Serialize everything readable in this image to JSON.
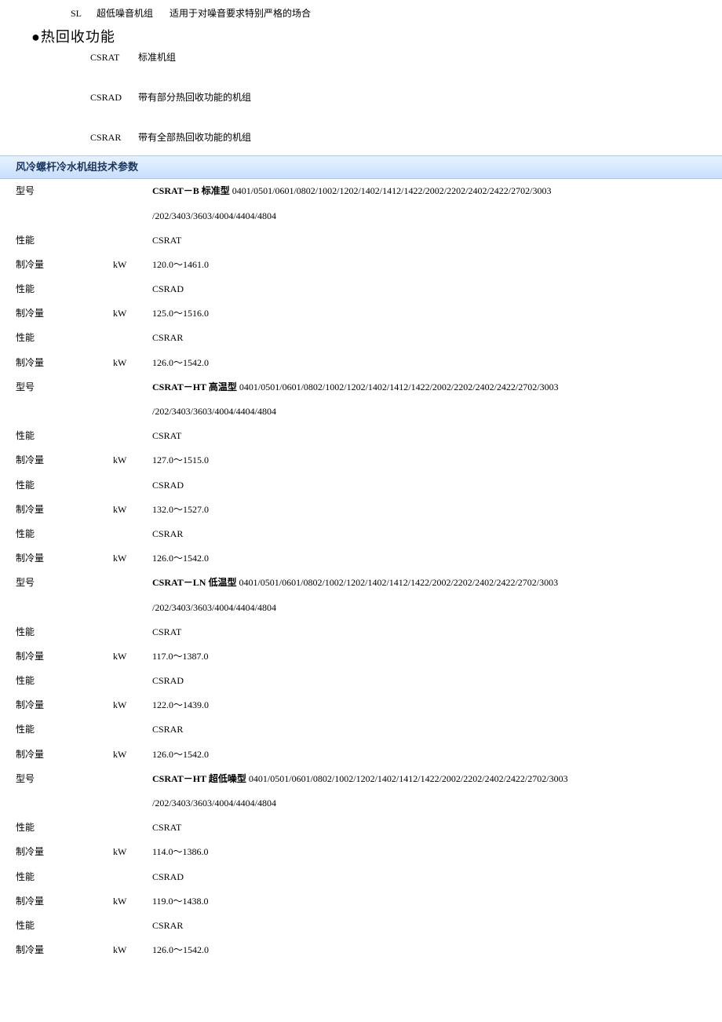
{
  "top_line": {
    "code": "SL",
    "label": "超低噪音机组",
    "desc": "适用于对噪音要求特别严格的场合"
  },
  "heading": "●热回收功能",
  "recovery": [
    {
      "code": "CSRAT",
      "desc": "标准机组"
    },
    {
      "code": "CSRAD",
      "desc": "带有部分热回收功能的机组"
    },
    {
      "code": "CSRAR",
      "desc": "带有全部热回收功能的机组"
    }
  ],
  "section_title": "风冷螺杆冷水机组技术参数",
  "model_suffix_line1": "0401/0501/0601/0802/1002/1202/1402/1412/1422/2002/2202/2402/2422/2702/3003",
  "model_suffix_line2": "/202/3403/3603/4004/4404/4804",
  "groups": [
    {
      "title_bold": "CSRAT－B 标准型",
      "rows": [
        {
          "label": "性能",
          "unit": "",
          "value": "CSRAT"
        },
        {
          "label": "制冷量",
          "unit": "kW",
          "value": "120.0～1461.0"
        },
        {
          "label": "性能",
          "unit": "",
          "value": "CSRAD"
        },
        {
          "label": "制冷量",
          "unit": "kW",
          "value": "125.0～1516.0"
        },
        {
          "label": "性能",
          "unit": "",
          "value": "CSRAR"
        },
        {
          "label": "制冷量",
          "unit": "kW",
          "value": "126.0～1542.0"
        }
      ]
    },
    {
      "title_bold": "CSRAT－HT 高温型",
      "rows": [
        {
          "label": "性能",
          "unit": "",
          "value": "CSRAT"
        },
        {
          "label": "制冷量",
          "unit": "kW",
          "value": "127.0～1515.0"
        },
        {
          "label": "性能",
          "unit": "",
          "value": "CSRAD"
        },
        {
          "label": "制冷量",
          "unit": "kW",
          "value": "132.0～1527.0"
        },
        {
          "label": "性能",
          "unit": "",
          "value": "CSRAR"
        },
        {
          "label": "制冷量",
          "unit": "kW",
          "value": "126.0～1542.0"
        }
      ]
    },
    {
      "title_bold": "CSRAT－LN 低温型",
      "rows": [
        {
          "label": "性能",
          "unit": "",
          "value": "CSRAT"
        },
        {
          "label": "制冷量",
          "unit": "kW",
          "value": "117.0～1387.0"
        },
        {
          "label": "性能",
          "unit": "",
          "value": "CSRAD"
        },
        {
          "label": "制冷量",
          "unit": "kW",
          "value": "122.0～1439.0"
        },
        {
          "label": "性能",
          "unit": "",
          "value": "CSRAR"
        },
        {
          "label": "制冷量",
          "unit": "kW",
          "value": "126.0～1542.0"
        }
      ]
    },
    {
      "title_bold": "CSRAT－HT 超低噪型",
      "rows": [
        {
          "label": "性能",
          "unit": "",
          "value": "CSRAT"
        },
        {
          "label": "制冷量",
          "unit": "kW",
          "value": "114.0～1386.0"
        },
        {
          "label": "性能",
          "unit": "",
          "value": "CSRAD"
        },
        {
          "label": "制冷量",
          "unit": "kW",
          "value": "119.0～1438.0"
        },
        {
          "label": "性能",
          "unit": "",
          "value": "CSRAR"
        },
        {
          "label": "制冷量",
          "unit": "kW",
          "value": "126.0～1542.0"
        }
      ]
    }
  ],
  "labels": {
    "model": "型号"
  }
}
